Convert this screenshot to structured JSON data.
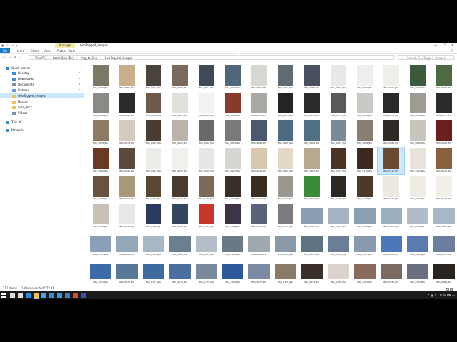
{
  "window": {
    "title": "GeoTagged_images",
    "context_group": "Manage",
    "controls": [
      "—",
      "☐",
      "✕"
    ]
  },
  "ribbon": {
    "tabs": [
      "File",
      "Home",
      "Share",
      "View",
      "Picture Tools"
    ],
    "help": "?"
  },
  "address": {
    "segments": [
      "This PC",
      "Local Disk (D:)",
      "Img_to_Shp",
      "GeoTagged_images"
    ],
    "search_placeholder": "Search GeoTagged_images"
  },
  "sidebar": {
    "items": [
      {
        "label": "Quick access",
        "icon": "star-icon",
        "color": "#2f86d6",
        "indent": 0,
        "pinned": false
      },
      {
        "label": "Desktop",
        "icon": "desktop-icon",
        "color": "#3a8fdc",
        "indent": 1,
        "pinned": true
      },
      {
        "label": "Downloads",
        "icon": "download-icon",
        "color": "#3a8fdc",
        "indent": 1,
        "pinned": true
      },
      {
        "label": "Documents",
        "icon": "documents-icon",
        "color": "#7a8ea6",
        "indent": 1,
        "pinned": true
      },
      {
        "label": "Pictures",
        "icon": "pictures-icon",
        "color": "#5aa0e6",
        "indent": 1,
        "pinned": true
      },
      {
        "label": "GeoTagged_images",
        "icon": "folder-icon",
        "color": "#e8c25a",
        "indent": 1,
        "pinned": false,
        "selected": true
      },
      {
        "label": "Movies",
        "icon": "folder-icon",
        "color": "#e8c25a",
        "indent": 1,
        "pinned": false
      },
      {
        "label": "nms_docs",
        "icon": "folder-icon",
        "color": "#e8c25a",
        "indent": 1,
        "pinned": false
      },
      {
        "label": "Videos",
        "icon": "videos-icon",
        "color": "#7a8ea6",
        "indent": 1,
        "pinned": false
      },
      {
        "label": "This PC",
        "icon": "computer-icon",
        "color": "#3a8fdc",
        "indent": 0,
        "pinned": false
      },
      {
        "label": "Network",
        "icon": "network-icon",
        "color": "#3a8fdc",
        "indent": 0,
        "pinned": false
      }
    ]
  },
  "files": [
    [
      "IMG_0050.JPG",
      "IMG_0051.JPG",
      "IMG_0052.JPG",
      "IMG_0053.JPG",
      "IMG_0054.JPG",
      "IMG_0055.JPG",
      "IMG_0056.JPG",
      "IMG_0057.JPG",
      "IMG_0058.JPG",
      "IMG_0059.JPG",
      "IMG_0060.JPG",
      "IMG_0061.JPG",
      "IMG_0062.JPG",
      "IMG_0063.JPG"
    ],
    [
      "IMG_0064.JPG",
      "IMG_0065.JPG",
      "IMG_0066.JPG",
      "IMG_0067.JPG",
      "IMG_0068.JPG",
      "IMG_0069.JPG",
      "IMG_0070.JPG",
      "IMG_0071.JPG",
      "IMG_0072.JPG",
      "IMG_0073.JPG",
      "IMG_0074.JPG",
      "IMG_0075.JPG",
      "IMG_0076.JPG",
      "IMG_0077.JPG"
    ],
    [
      "IMG_0078.JPG",
      "IMG_0079.JPG",
      "IMG_0080.JPG",
      "IMG_0081.JPG",
      "IMG_0082.JPG",
      "IMG_0083.JPG",
      "IMG_0084.JPG",
      "IMG_0085.JPG",
      "IMG_0086.JPG",
      "IMG_0087.JPG",
      "IMG_0088.JPG",
      "IMG_0089.JPG",
      "IMG_0090.JPG",
      "IMG_0091.JPG"
    ],
    [
      "IMG_0092.JPG",
      "IMG_0093.JPG",
      "IMG_0094.JPG",
      "IMG_0095.JPG",
      "IMG_0096.JPG",
      "IMG_0097.JPG",
      "IMG_0098.JPG",
      "IMG_0099.JPG",
      "IMG_0100.JPG",
      "IMG_0101.JPG",
      "IMG_0110.JPG",
      "IMG_0112.JPG",
      "IMG_0113.JPG",
      "IMG_0117.JPG"
    ],
    [
      "IMG_0118.JPG",
      "IMG_0120.JPG",
      "IMG_0126.JPG",
      "IMG_0127.JPG",
      "IMG_0128.JPG",
      "IMG_0129.JPG",
      "IMG_0130.JPG",
      "IMG_0131.JPG",
      "IMG_0133.JPG",
      "IMG_0136.JPG",
      "IMG_0138.JPG",
      "IMG_0140.JPG",
      "IMG_0141.JPG",
      "IMG_0142.JPG"
    ],
    [
      "IMG_0143.JPG",
      "IMG_0144.JPG",
      "IMG_0145.JPG",
      "IMG_0146.JPG",
      "IMG_0147.JPG",
      "IMG_0148.JPG",
      "IMG_0149.JPG",
      "IMG_0150.JPG",
      "IMG_0151.JPG",
      "IMG_0152.JPG",
      "IMG_0153.JPG",
      "IMG_0154.JPG",
      "IMG_0155.JPG",
      "IMG_0156.JPG"
    ],
    [
      "IMG_0157.JPG",
      "IMG_0158.JPG",
      "IMG_0159.JPG",
      "IMG_0160.JPG",
      "IMG_0161.JPG",
      "IMG_0162.JPG",
      "IMG_0163.JPG",
      "IMG_0164.JPG",
      "IMG_0165.JPG",
      "IMG_0166.JPG",
      "IMG_0167.JPG",
      "IMG_0168.JPG",
      "IMG_0169.JPG",
      "IMG_0170.JPG"
    ],
    [
      "IMG_0171.JPG",
      "IMG_0172.JPG",
      "IMG_0173.JPG",
      "IMG_0174.JPG",
      "IMG_0175.JPG",
      "IMG_0176.JPG",
      "IMG_0177.JPG",
      "IMG_0178.JPG",
      "IMG_0179.JPG",
      "IMG_0180.JPG",
      "IMG_0181.JPG",
      "IMG_0182.JPG",
      "IMG_0183.JPG",
      "IMG_0184.JPG"
    ]
  ],
  "thumbnail_colors": [
    [
      "#7c7868",
      "#c9b08a",
      "#4b443c",
      "#7a6a5e",
      "#3f4a58",
      "#50667a",
      "#d8d8d2",
      "#5f6a72",
      "#4a5060",
      "#e8e8e6",
      "#eeeeec",
      "#f0eeea",
      "#3e5a3c",
      "#4e6a44"
    ],
    [
      "#8c8a86",
      "#2e2a28",
      "#6e5a4a",
      "#e2e0da",
      "#f4f2ee",
      "#8a3a2a",
      "#a8a8a4",
      "#242424",
      "#2c2c2c",
      "#5a5a58",
      "#c8c8c4",
      "#2a2a2a",
      "#9e9a96",
      "#2c2c2c"
    ],
    [
      "#8c7a62",
      "#d4ccc0",
      "#4a3c30",
      "#bcb4a8",
      "#6a6868",
      "#7a7a78",
      "#4a5a6e",
      "#4e6a80",
      "#506e84",
      "#7a8a96",
      "#8a7e72",
      "#2e2a26",
      "#c8c4be",
      "#6a1e1e"
    ],
    [
      "#6a3a22",
      "#5a4a3c",
      "#eeece8",
      "#f2f0ec",
      "#e8e6e2",
      "#d8d6d2",
      "#d8c8b0",
      "#e4d8c8",
      "#b8a890",
      "#4a3226",
      "#3c2a20",
      "#6a4a32",
      "#e8e4dc",
      "#8a6040"
    ],
    [
      "#6a5240",
      "#a89878",
      "#5a4836",
      "#4a3c2c",
      "#7a6a5a",
      "#3a3028",
      "#3a2e22",
      "#9a9890",
      "#3a8a3a",
      "#2c2824",
      "#4a3a2c",
      "#ece8e2",
      "#f0ece6",
      "#f2eee8"
    ],
    [
      "#c8c0b4",
      "#eae8e4",
      "#2a3a5e",
      "#34465e",
      "#c8362a",
      "#3e3448",
      "#5a6478",
      "#7a7c80",
      "#8a9cb2",
      "#a6b4c2",
      "#8aa0b0",
      "#9ab0c0",
      "#b0bcc8",
      "#a8b8c6"
    ],
    [
      "#8aa0b8",
      "#94a8b8",
      "#a8b8c4",
      "#6a8090",
      "#b4bec8",
      "#6a7888",
      "#a0a8b0",
      "#8a9aa8",
      "#5e7484",
      "#6a7e98",
      "#8a9aae",
      "#4a78b8",
      "#5a7ab0",
      "#6a7fa0"
    ],
    [
      "#3a6aa8",
      "#587898",
      "#3e6aa0",
      "#4a6e9e",
      "#7a8a9c",
      "#2e5a9c",
      "#7a8aa2",
      "#8a7a68",
      "#3a2e2a",
      "#dcd4cc",
      "#8a6a5a",
      "#7a6a62",
      "#6a7080",
      "#2a2420"
    ]
  ],
  "selected_file": "IMG_0112.JPG",
  "status": {
    "item_count": "111 items",
    "selection": "1 item selected  572 KB"
  },
  "taskbar": {
    "apps": [
      {
        "name": "search-taskbar-icon",
        "color": "#dddddd"
      },
      {
        "name": "task-view-icon",
        "color": "#dddddd"
      },
      {
        "name": "edge-icon",
        "color": "#2a8ae0"
      },
      {
        "name": "file-explorer-icon",
        "color": "#e8c25a",
        "active": true
      },
      {
        "name": "store-icon",
        "color": "#4aa0e6"
      },
      {
        "name": "mail-icon",
        "color": "#3a8ad6"
      },
      {
        "name": "arcgis-icon",
        "color": "#3a9ad8"
      },
      {
        "name": "app-icon",
        "color": "#4a7ab8"
      },
      {
        "name": "chrome-icon",
        "color": "#d84a3a"
      },
      {
        "name": "word-icon",
        "color": "#2a5aa8"
      }
    ],
    "clock": "9:18 PM"
  }
}
